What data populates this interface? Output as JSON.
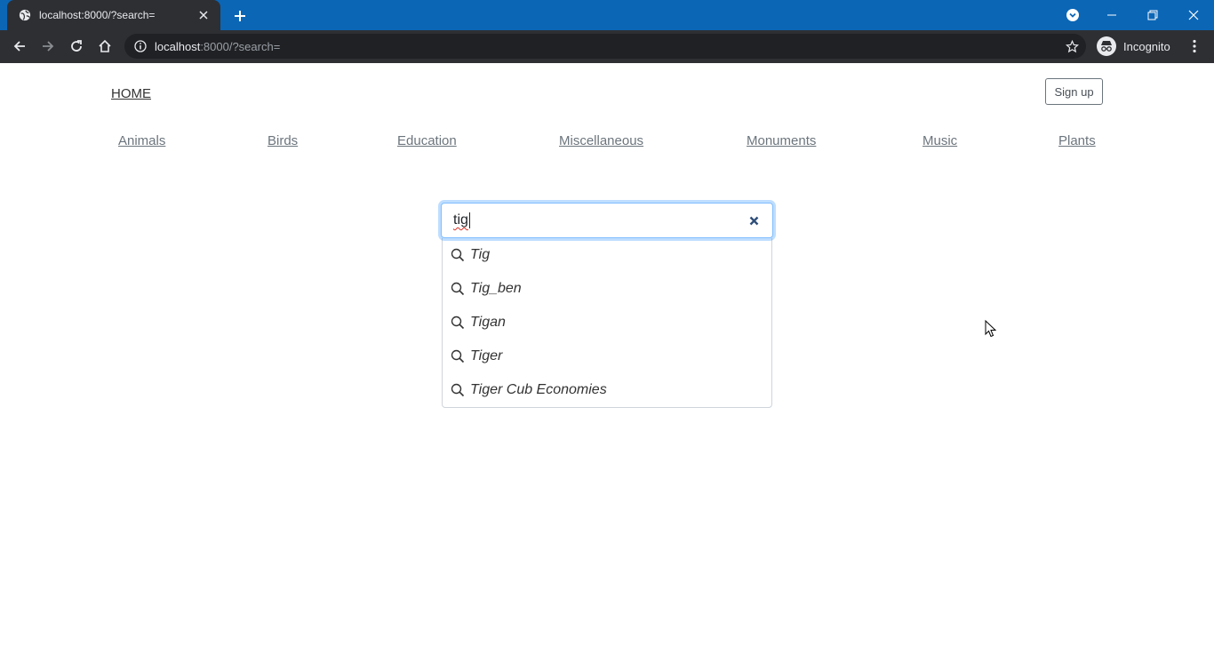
{
  "browser": {
    "tab_title": "localhost:8000/?search=",
    "url_host": "localhost",
    "url_rest": ":8000/?search=",
    "profile_label": "Incognito",
    "colors": {
      "tabstrip": "#0b66b6",
      "toolbar": "#2e2f33"
    }
  },
  "nav": {
    "home": "HOME",
    "signup": "Sign up",
    "categories": [
      "Animals",
      "Birds",
      "Education",
      "Miscellaneous",
      "Monuments",
      "Music",
      "Plants"
    ]
  },
  "search": {
    "value": "tig",
    "suggestions": [
      "Tig",
      "Tig_ben",
      "Tigan",
      "Tiger",
      "Tiger Cub Economies"
    ]
  }
}
